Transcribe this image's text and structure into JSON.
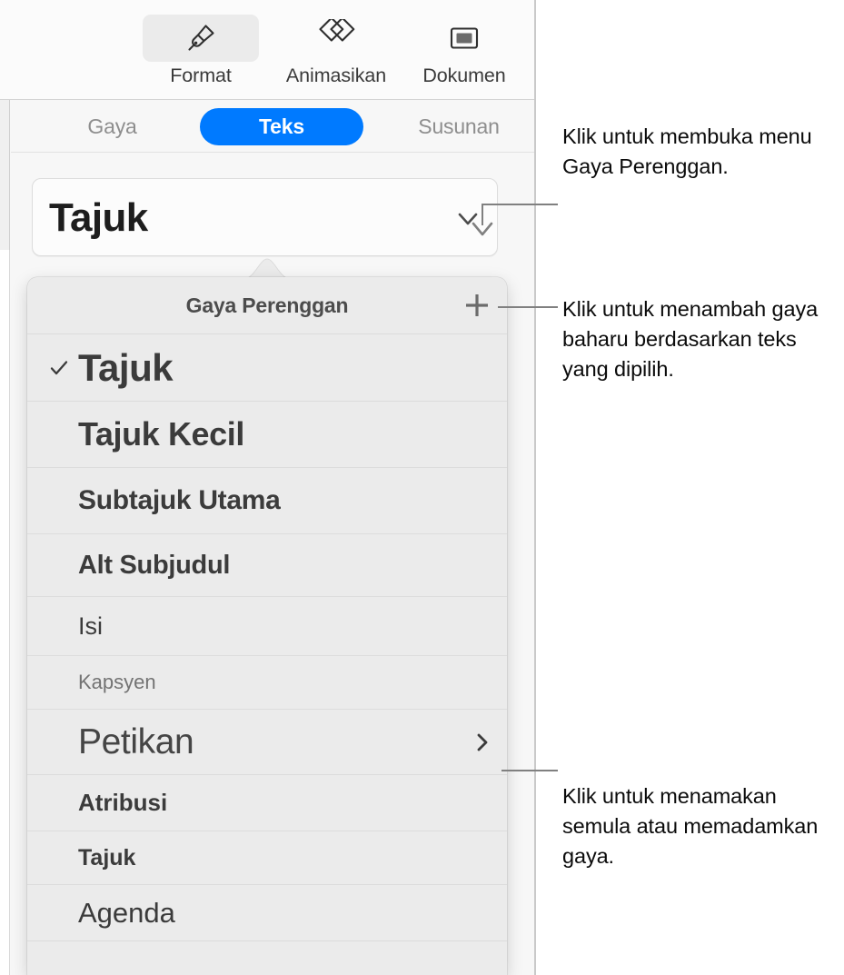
{
  "toolbar": {
    "items": [
      {
        "label": "Format",
        "icon": "paintbrush-icon",
        "active": true
      },
      {
        "label": "Animasikan",
        "icon": "diamonds-icon",
        "active": false
      },
      {
        "label": "Dokumen",
        "icon": "document-rect-icon",
        "active": false
      }
    ]
  },
  "tabs": {
    "items": [
      {
        "label": "Gaya",
        "selected": false
      },
      {
        "label": "Teks",
        "selected": true
      },
      {
        "label": "Susunan",
        "selected": false
      }
    ],
    "selected_color": "#007aff"
  },
  "style_button": {
    "value": "Tajuk",
    "chevron_icon": "chevron-down-icon"
  },
  "popup": {
    "title": "Gaya Perenggan",
    "add_icon": "plus-icon",
    "items": [
      {
        "label": "Tajuk",
        "checked": true,
        "submenu": false
      },
      {
        "label": "Tajuk Kecil",
        "checked": false,
        "submenu": false
      },
      {
        "label": "Subtajuk Utama",
        "checked": false,
        "submenu": false
      },
      {
        "label": "Alt Subjudul",
        "checked": false,
        "submenu": false
      },
      {
        "label": "Isi",
        "checked": false,
        "submenu": false
      },
      {
        "label": "Kapsyen",
        "checked": false,
        "submenu": false
      },
      {
        "label": "Petikan",
        "checked": false,
        "submenu": true
      },
      {
        "label": "Atribusi",
        "checked": false,
        "submenu": false
      },
      {
        "label": "Tajuk",
        "checked": false,
        "submenu": false
      },
      {
        "label": "Agenda",
        "checked": false,
        "submenu": false
      }
    ]
  },
  "callouts": {
    "open_menu": "Klik untuk membuka menu Gaya Perenggan.",
    "add_style": "Klik untuk menambah gaya baharu berdasarkan teks yang dipilih.",
    "rename_delete": "Klik untuk menamakan semula atau memadamkan gaya."
  }
}
